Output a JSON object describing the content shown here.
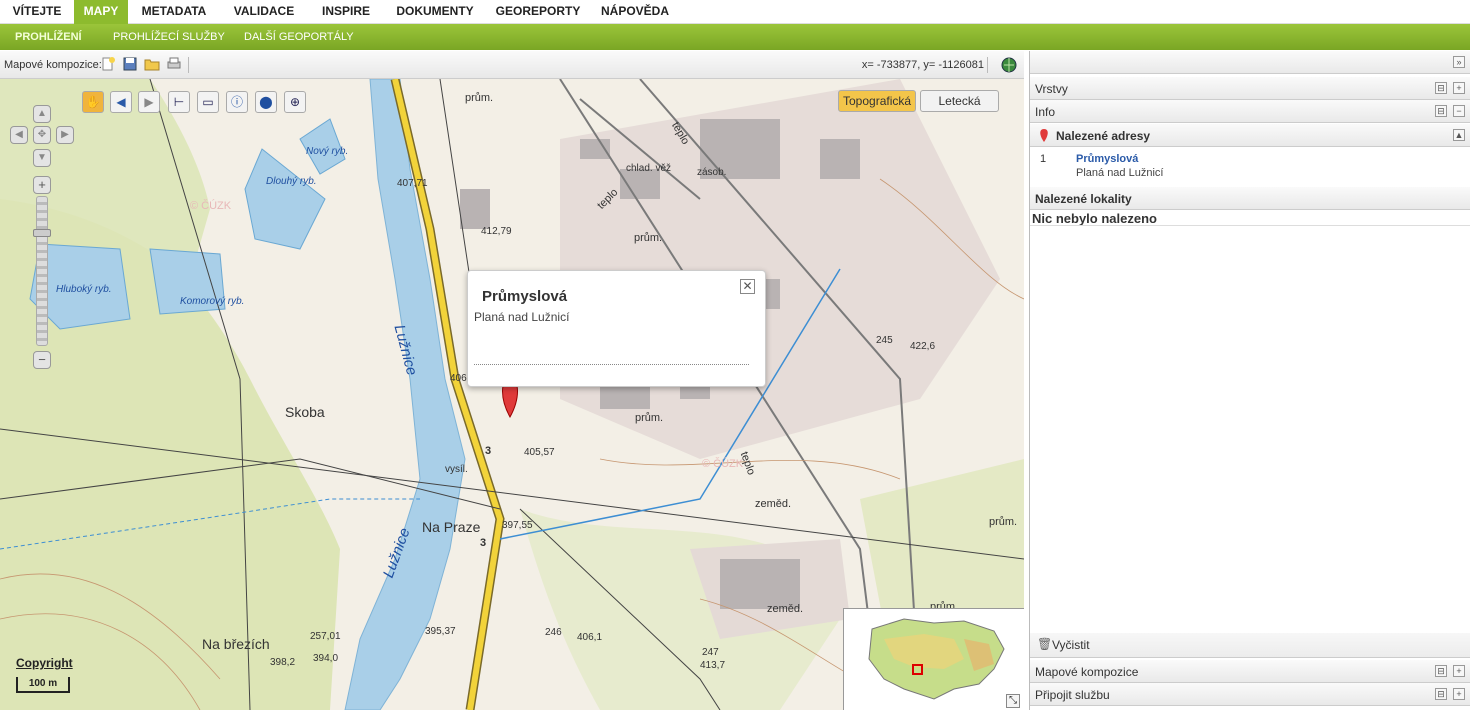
{
  "top_nav": {
    "tabs": [
      {
        "label": "VÍTEJTE",
        "active": false
      },
      {
        "label": "MAPY",
        "active": true
      },
      {
        "label": "METADATA",
        "active": false
      },
      {
        "label": "VALIDACE",
        "active": false
      },
      {
        "label": "INSPIRE",
        "active": false
      },
      {
        "label": "DOKUMENTY",
        "active": false
      },
      {
        "label": "GEOREPORTY",
        "active": false
      },
      {
        "label": "NÁPOVĚDA",
        "active": false
      }
    ]
  },
  "sub_nav": {
    "items": [
      {
        "label": "PROHLÍŽENÍ",
        "active": true
      },
      {
        "label": "PROHLÍŽECÍ SLUŽBY",
        "active": false
      },
      {
        "label": "DALŠÍ GEOPORTÁLY",
        "active": false
      }
    ]
  },
  "map_toolbar": {
    "compositions_label": "Mapové kompozice:",
    "coords": "x= -733877, y= -1126081"
  },
  "map": {
    "layer_buttons": [
      {
        "label": "Topografická",
        "active": true
      },
      {
        "label": "Letecká",
        "active": false
      }
    ],
    "popup": {
      "title": "Průmyslová",
      "subtitle": "Planá nad Lužnicí",
      "close": "✕"
    },
    "marker_number": "1",
    "copyright": "Copyright",
    "scale": "100 m",
    "labels": {
      "luznice1": "Lužnice",
      "luznice2": "Lužnice",
      "skoba": "Skoba",
      "na_praze": "Na Praze",
      "na_brezich": "Na březích",
      "hluboky": "Hluboký ryb.",
      "komorovy": "Komorový ryb.",
      "dlouhy": "Dlouhý ryb.",
      "novy": "Nový ryb.",
      "prum1": "prům.",
      "prum2": "prům.",
      "prum3": "prům.",
      "prum4": "prům.",
      "prum5": "prům.",
      "teplo1": "teplo",
      "teplo2": "teplo",
      "teplo3": "teplo",
      "zemed1": "zeměd.",
      "zemed2": "zeměd.",
      "chlad": "chlad. věž",
      "zasob": "zásob.",
      "vysil": "vysíl.",
      "e1": "407,71",
      "e2": "412,79",
      "e3": "406,03",
      "e4": "405,57",
      "e5": "397,55",
      "e6": "395,37",
      "e7": "257,01",
      "e8": "398,2",
      "e9": "394,0",
      "e10": "406,1",
      "e11": "413,7",
      "e12": "422,6",
      "e13": "245",
      "e14": "246",
      "e15": "247",
      "e16": "3",
      "e17": "3",
      "cz1": "© ČÚZK",
      "cz2": "© ČÚZK"
    }
  },
  "sidebar": {
    "panels": [
      {
        "label": "Vrstvy"
      },
      {
        "label": "Info"
      }
    ],
    "found_addresses": {
      "title": "Nalezené adresy",
      "results": [
        {
          "num": "1",
          "name": "Průmyslová",
          "town": "Planá nad Lužnicí"
        }
      ]
    },
    "found_localities": {
      "title": "Nalezené lokality",
      "empty": "Nic nebylo nalezeno"
    },
    "clear_label": "Vyčistit",
    "bottom_panels": [
      {
        "label": "Mapové kompozice"
      },
      {
        "label": "Připojit službu"
      }
    ]
  },
  "colors": {
    "accent": "#8dbb2e",
    "water": "#a9cfe8",
    "forest": "#dce6b4",
    "road": "#f2d33a"
  }
}
